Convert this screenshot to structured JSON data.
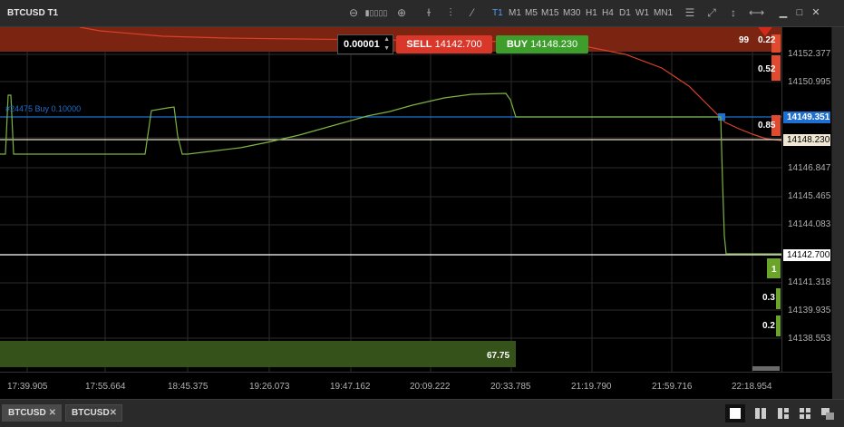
{
  "window": {
    "title": "BTCUSD T1"
  },
  "toolbar": {
    "timeframes": [
      "T1",
      "M1",
      "M5",
      "M15",
      "M30",
      "H1",
      "H4",
      "D1",
      "W1",
      "MN1"
    ],
    "active_timeframe": "T1",
    "icons": [
      "zoom-out-icon",
      "zoom-slider-icon",
      "zoom-in-icon",
      "crosshair-icon",
      "candle-chart-icon",
      "line-chart-icon",
      "indicators-icon",
      "draw-line-icon",
      "measure-icon"
    ]
  },
  "trade_panel": {
    "quantity": "0.00001",
    "sell_label": "SELL",
    "sell_price": "14142.700",
    "buy_label": "BUY",
    "buy_price": "14148.230"
  },
  "order_line": {
    "label": "#24475 Buy 0.10000"
  },
  "depth": {
    "top_left_volume": "99",
    "ask_sizes": [
      "0.22",
      "0.52",
      "0.85"
    ],
    "bid_sizes": [
      "1",
      "0.3",
      "0.2"
    ],
    "bottom_bar_volume": "67.75"
  },
  "price_axis": {
    "labels": [
      "14152.377",
      "14150.995",
      "14146.847",
      "14145.465",
      "14144.083",
      "14141.318",
      "14139.935",
      "14138.553"
    ],
    "order_price": "14149.351",
    "ask_price": "14148.230",
    "bid_price": "14142.700"
  },
  "time_axis": {
    "labels": [
      "17:39.905",
      "17:55.664",
      "18:45.375",
      "19:26.073",
      "19:47.162",
      "20:09.222",
      "20:33.785",
      "21:19.790",
      "21:59.716",
      "22:18.954"
    ]
  },
  "tabs": [
    {
      "label": "BTCUSD",
      "active": true
    },
    {
      "label": "BTCUSD",
      "active": false
    }
  ],
  "colors": {
    "sell": "#d9372a",
    "buy": "#3e9e2c",
    "order_line": "#1e6fd0",
    "ask_line": "#e6dcc8",
    "bid_line": "#ffffff",
    "price_curve": "#7cb342",
    "red_curve": "#d8422a"
  }
}
